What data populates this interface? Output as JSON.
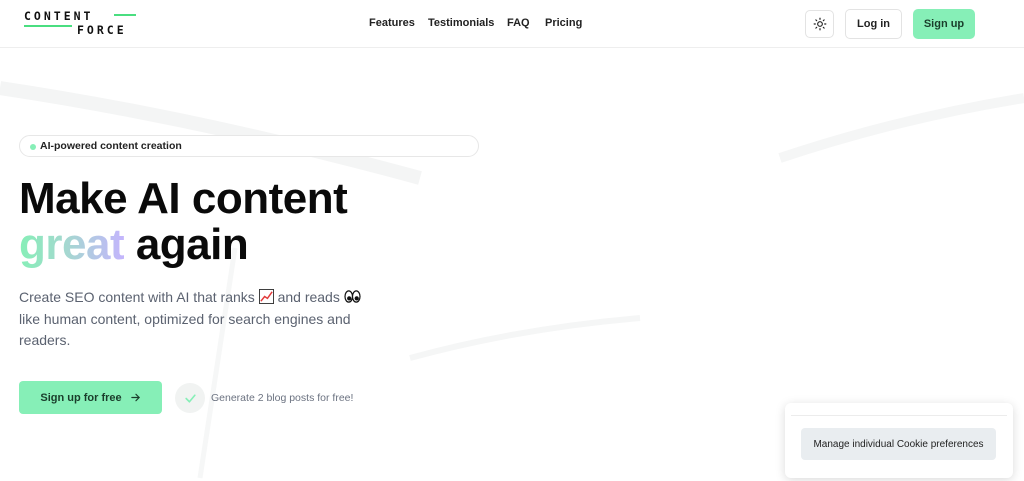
{
  "brand": {
    "line1": "CONTENT",
    "line2": "FORCE",
    "accent": "#4ade80"
  },
  "nav": {
    "items": [
      "Features",
      "Testimonials",
      "FAQ",
      "Pricing"
    ]
  },
  "header": {
    "theme_icon": "sun-icon",
    "login": "Log in",
    "signup": "Sign up"
  },
  "hero": {
    "badge": "AI-powered content creation",
    "title_line1": "Make AI content",
    "title_highlight": "great",
    "title_line2_rest": " again",
    "subtitle_part1": "Create SEO content with AI that ranks ",
    "subtitle_part2": " and reads ",
    "subtitle_part3": " like human content, optimized for search engines and readers.",
    "ranks_icon": "chart-increasing-icon",
    "reads_icon": "eyes-icon",
    "cta": "Sign up for free",
    "cta_icon": "arrow-right-icon",
    "free_note": "Generate 2 blog posts for free!"
  },
  "cookie": {
    "button": "Manage individual Cookie preferences"
  },
  "colors": {
    "primary": "#86efb7",
    "gradient_end": "#c4b5fd",
    "muted_text": "#5b6270"
  }
}
